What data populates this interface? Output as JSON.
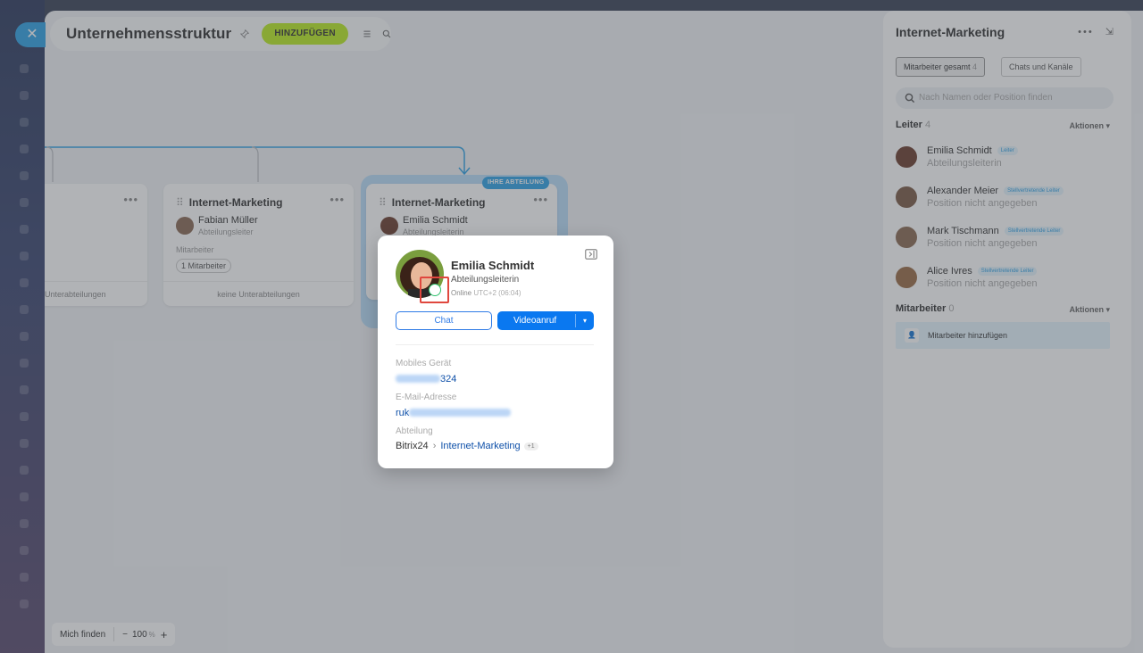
{
  "app": {
    "close_icon": "close-icon",
    "title": "Unternehmensstruktur",
    "add_button": "HINZUFÜGEN",
    "pin_icon": "pin-icon",
    "menu_icon": "menu-icon",
    "search_icon": "search-icon"
  },
  "cards": [
    {
      "title": "",
      "footer": "Unterabteilungen"
    },
    {
      "title": "Internet-Marketing",
      "head_name": "Fabian Müller",
      "head_position": "Abteilungsleiter",
      "employees_label": "Mitarbeiter",
      "employees_count": "1 Mitarbeiter",
      "footer": "keine Unterabteilungen"
    },
    {
      "title": "Internet-Marketing",
      "badge": "IHRE ABTEILUNG",
      "head_name": "Emilia Schmidt",
      "head_position": "Abteilungsleiterin"
    }
  ],
  "bottom": {
    "find_me": "Mich finden",
    "zoom_out": "−",
    "zoom_value": "100",
    "zoom_unit": "%",
    "zoom_in": "+"
  },
  "right_panel": {
    "title": "Internet-Marketing",
    "more_icon": "more-icon",
    "collapse_icon": "collapse-icon",
    "tabs": [
      {
        "label": "Mitarbeiter gesamt",
        "count": "4"
      },
      {
        "label": "Chats und Kanäle",
        "count": ""
      }
    ],
    "search_placeholder": "Nach Namen oder Position finden",
    "leaders_label": "Leiter",
    "leaders_count": "4",
    "actions_label": "Aktionen",
    "leaders": [
      {
        "name": "Emilia Schmidt",
        "tag": "Leiter",
        "position": "Abteilungsleiterin"
      },
      {
        "name": "Alexander Meier",
        "tag": "Stellvertretende Leiter",
        "position": "Position nicht angegeben"
      },
      {
        "name": "Mark Tischmann",
        "tag": "Stellvertretende Leiter",
        "position": "Position nicht angegeben"
      },
      {
        "name": "Alice Ivres",
        "tag": "Stellvertretende Leiter",
        "position": "Position nicht angegeben"
      }
    ],
    "employees_label": "Mitarbeiter",
    "employees_count": "0",
    "add_employee": "Mitarbeiter hinzufügen"
  },
  "popup": {
    "name": "Emilia Schmidt",
    "position": "Abteilungsleiterin",
    "status": "Online",
    "timezone": "UTC+2 (06:04)",
    "chat_button": "Chat",
    "video_button": "Videoanruf",
    "mobile_label": "Mobiles Gerät",
    "mobile_visible": "324",
    "email_label": "E-Mail-Adresse",
    "email_visible": "ruk",
    "dept_label": "Abteilung",
    "dept_root": "Bitrix24",
    "dept_link": "Internet-Marketing",
    "dept_more": "+1"
  },
  "colors": {
    "accent_blue": "#0a78f0",
    "add_green": "#bbed21",
    "online_green": "#2fc26d",
    "highlight_red": "#e0473e"
  }
}
